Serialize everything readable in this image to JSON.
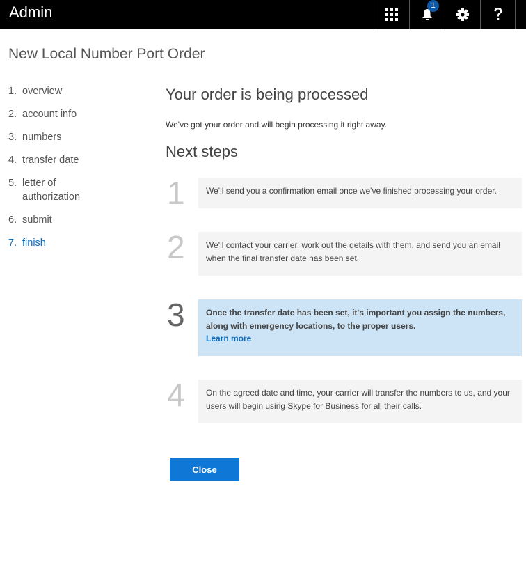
{
  "header": {
    "app_title": "Admin",
    "notification_count": "1",
    "icons": [
      "app-launcher-icon",
      "bell-icon",
      "gear-icon",
      "help-icon"
    ]
  },
  "page_title": "New Local Number Port Order",
  "nav": {
    "items": [
      {
        "num": "1.",
        "label": "overview",
        "active": false
      },
      {
        "num": "2.",
        "label": "account info",
        "active": false
      },
      {
        "num": "3.",
        "label": "numbers",
        "active": false
      },
      {
        "num": "4.",
        "label": "transfer date",
        "active": false
      },
      {
        "num": "5.",
        "label": "letter of authorization",
        "active": false
      },
      {
        "num": "6.",
        "label": "submit",
        "active": false
      },
      {
        "num": "7.",
        "label": "finish",
        "active": true
      }
    ]
  },
  "main": {
    "heading": "Your order is being processed",
    "intro": "We've got your order and will begin processing it right away.",
    "next_steps_heading": "Next steps",
    "steps": [
      {
        "num": "1",
        "text": "We'll send you a confirmation email once we've finished processing your order."
      },
      {
        "num": "2",
        "text": "We'll contact your carrier, work out the details with them, and send you an email when the final transfer date has been set."
      },
      {
        "num": "3",
        "text": "Once the transfer date has been set, it's important you assign the numbers, along with emergency locations, to the proper users.",
        "link": "Learn more"
      },
      {
        "num": "4",
        "text": "On the agreed date and time, your carrier will transfer the numbers to us, and your users will begin using Skype for Business for all their calls."
      }
    ],
    "close_label": "Close"
  },
  "colors": {
    "accent": "#0f78d7",
    "link": "#0f6cbd",
    "highlight_bg": "#cde4f6",
    "step_bg": "#f4f4f4",
    "topbar": "#000000"
  }
}
